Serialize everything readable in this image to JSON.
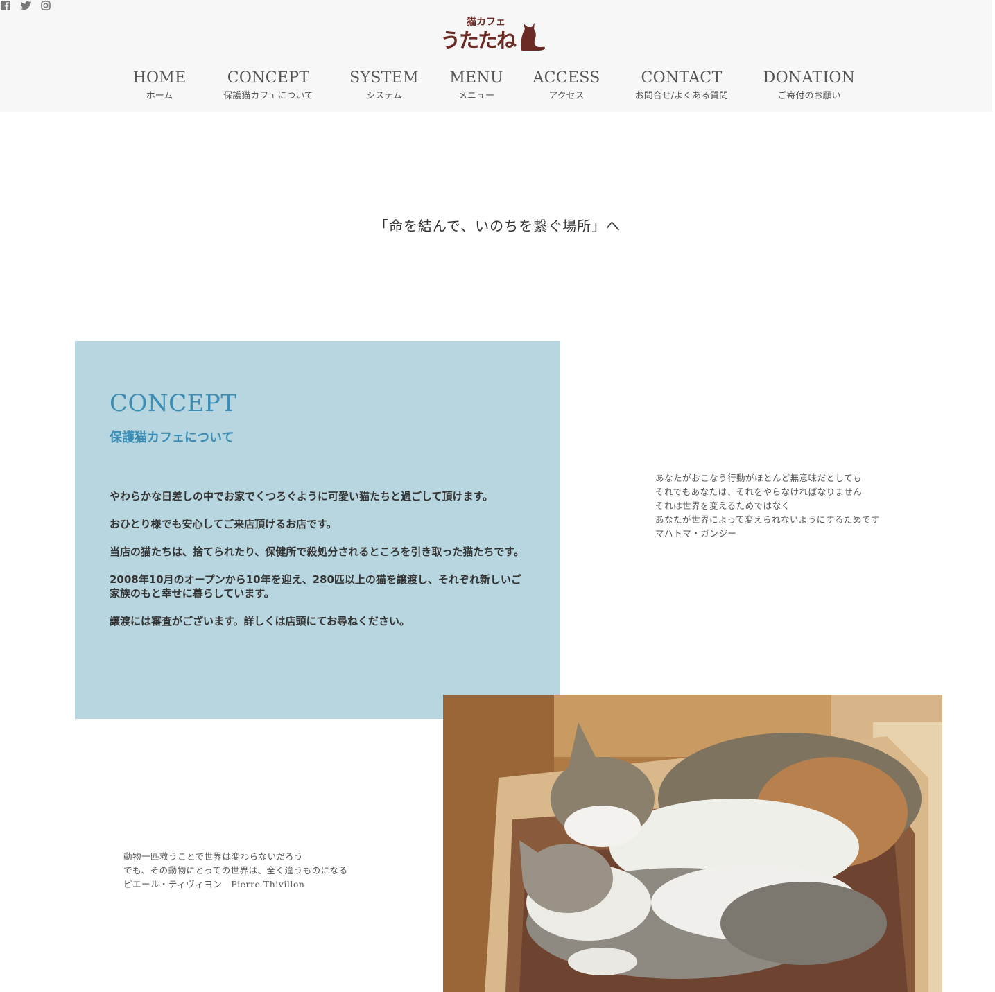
{
  "header": {
    "social": [
      {
        "name": "facebook-icon"
      },
      {
        "name": "twitter-icon"
      },
      {
        "name": "instagram-icon"
      }
    ],
    "logo": {
      "small_text": "猫カフェ",
      "main_text": "うたたね"
    }
  },
  "nav": {
    "items": [
      {
        "en": "HOME",
        "jp": "ホーム"
      },
      {
        "en": "CONCEPT",
        "jp": "保護猫カフェについて"
      },
      {
        "en": "SYSTEM",
        "jp": "システム"
      },
      {
        "en": "MENU",
        "jp": "メニュー"
      },
      {
        "en": "ACCESS",
        "jp": "アクセス"
      },
      {
        "en": "CONTACT",
        "jp": "お問合せ/よくある質問"
      },
      {
        "en": "DONATION",
        "jp": "ご寄付のお願い"
      }
    ]
  },
  "tagline": "「命を結んで、いのちを繋ぐ場所」へ",
  "concept": {
    "title": "CONCEPT",
    "subtitle": "保護猫カフェについて",
    "paragraphs": [
      "やわらかな日差しの中でお家でくつろぐように可愛い猫たちと過ごして頂けます。",
      "おひとり様でも安心してご来店頂けるお店です。",
      "当店の猫たちは、捨てられたり、保健所で殺処分されるところを引き取った猫たちです。",
      "2008年10月のオープンから10年を迎え、280匹以上の猫を譲渡し、それぞれ新しいご家族のもと幸せに暮らしています。",
      "譲渡には審査がございます。詳しくは店頭にてお尋ねください。"
    ]
  },
  "quote1": {
    "lines": [
      "あなたがおこなう行動がほとんど無意味だとしても",
      "それでもあなたは、それをやらなければなりません",
      "それは世界を変えるためではなく",
      "あなたが世界によって変えられないようにするためです",
      "マハトマ・ガンジー"
    ]
  },
  "quote2": {
    "lines": [
      "動物一匹救うことで世界は変わらないだろう",
      "でも、その動物にとっての世界は、全く違うものになる",
      "ピエール・ティヴィヨン　Pierre Thivillon"
    ]
  },
  "colors": {
    "accent": "#3a8db5",
    "concept_bg": "#b8d6df",
    "header_bg": "#f7f7f7",
    "logo": "#6b2a24"
  }
}
